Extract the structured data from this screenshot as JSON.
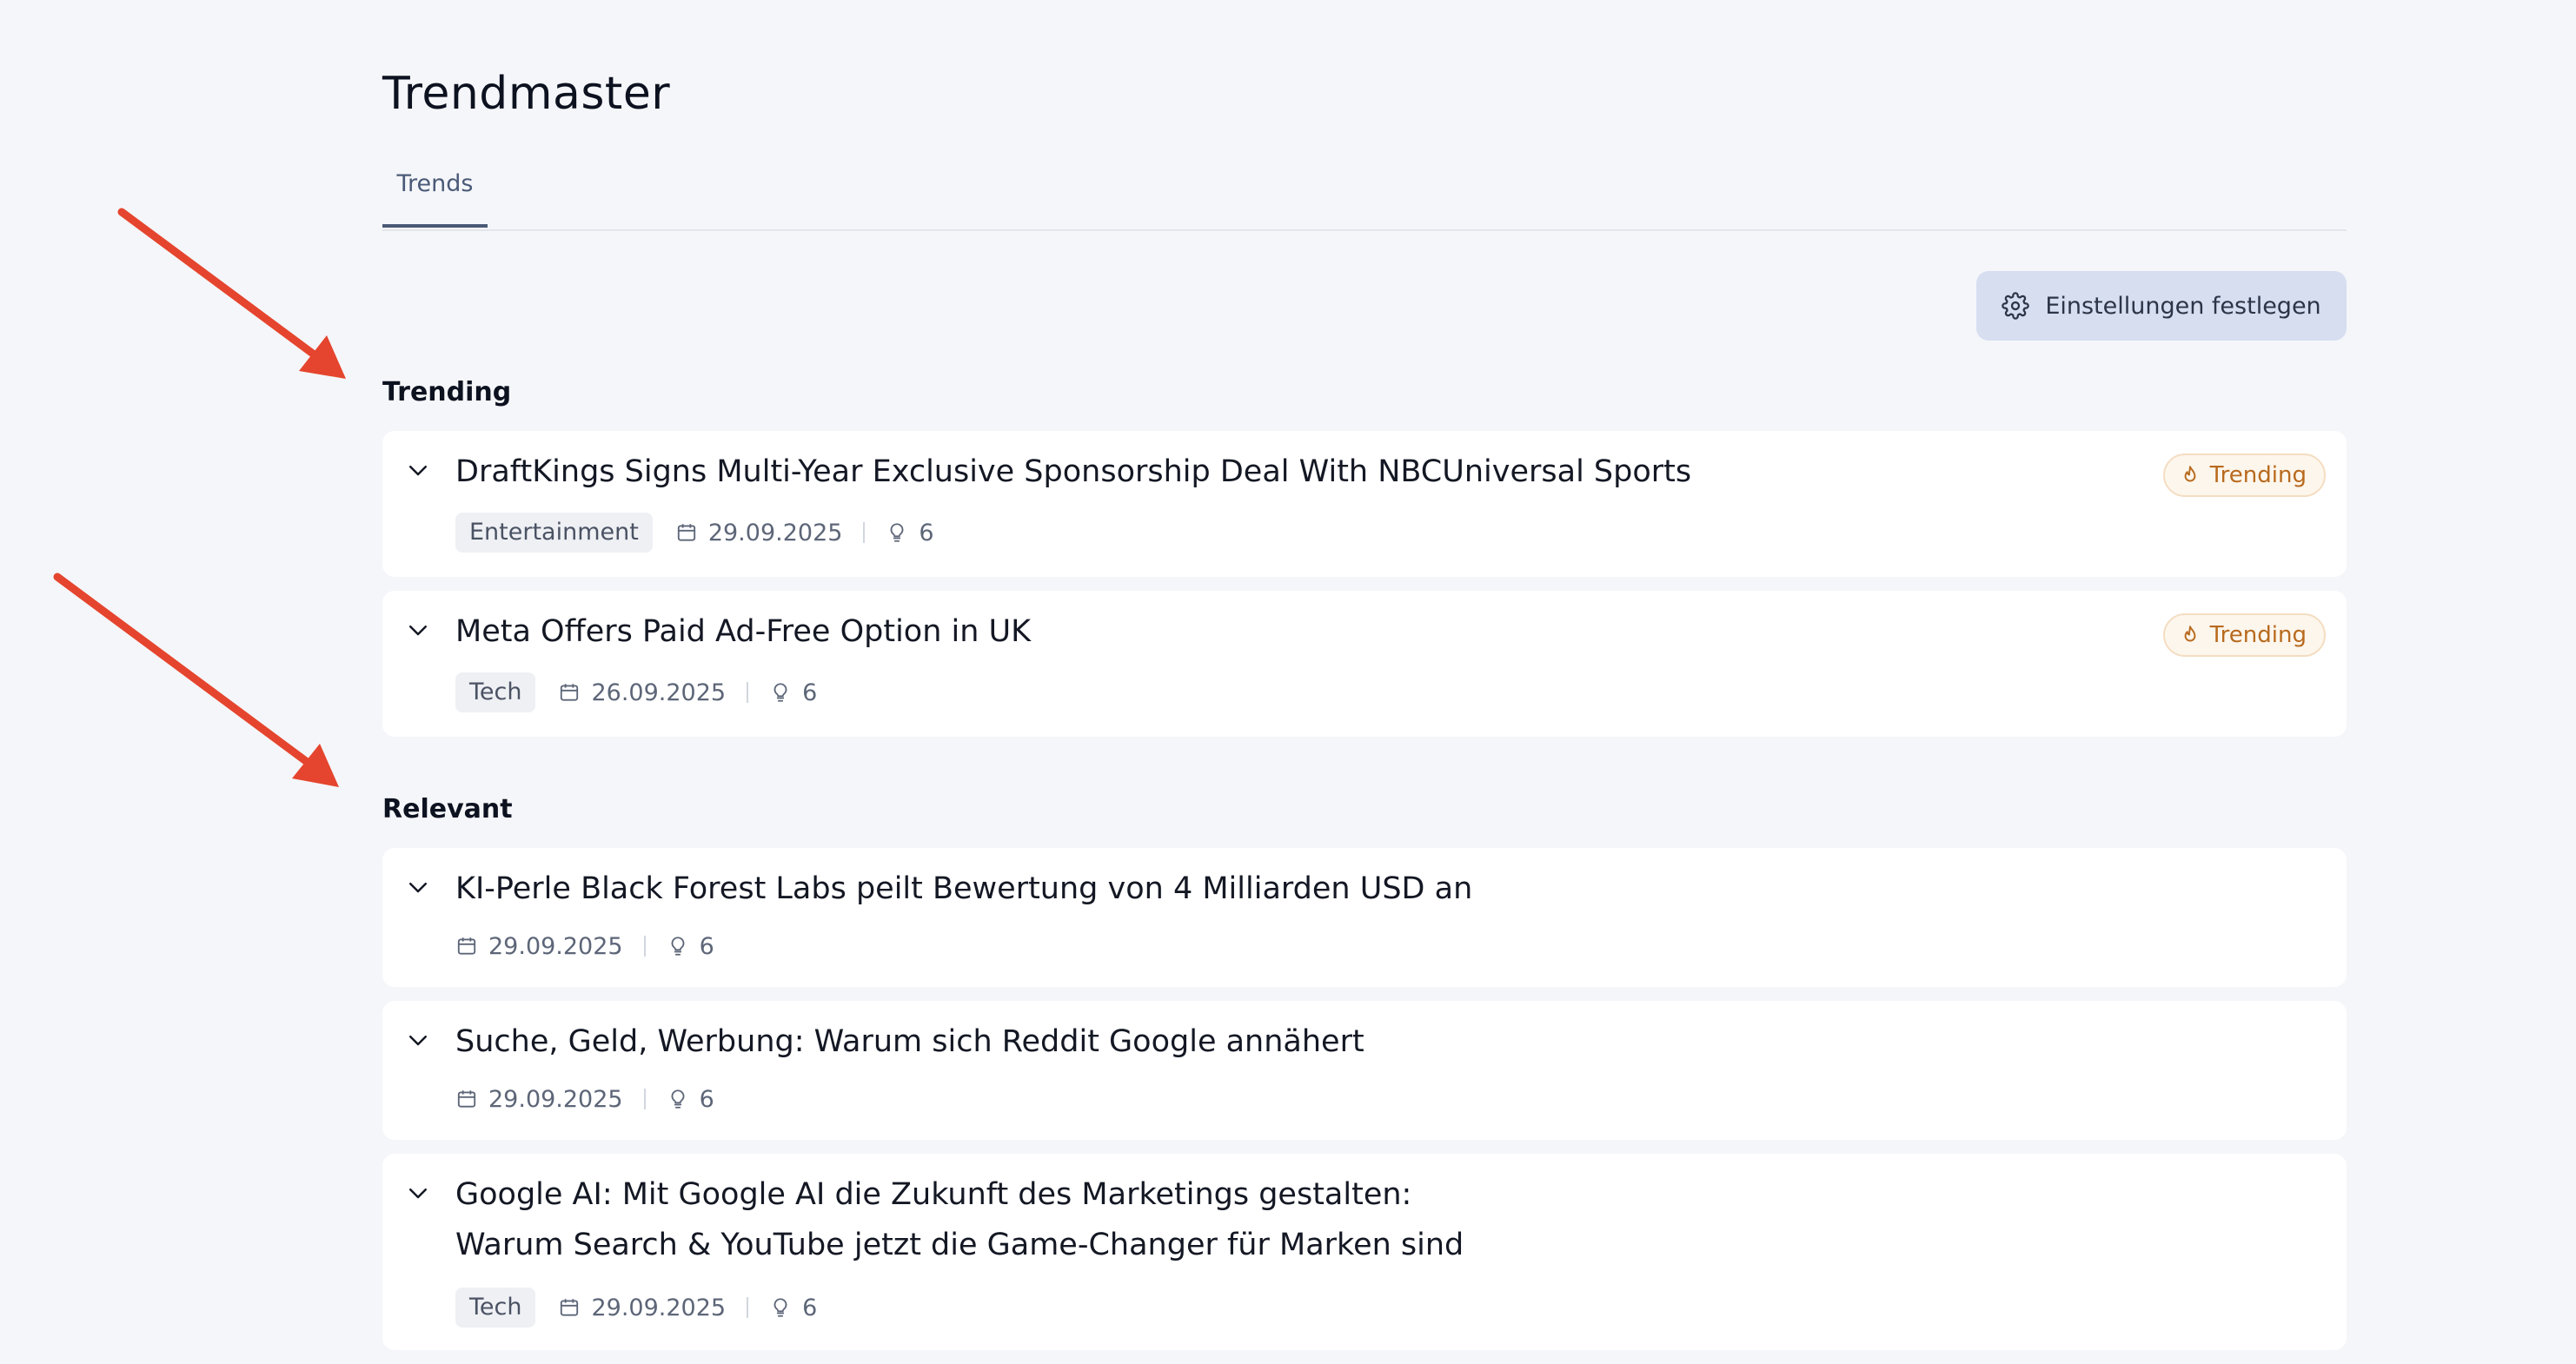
{
  "app": {
    "title": "Trendmaster"
  },
  "tabs": [
    {
      "label": "Trends"
    }
  ],
  "toolbar": {
    "settings_label": "Einstellungen festlegen"
  },
  "sections": {
    "trending": {
      "title": "Trending",
      "items": [
        {
          "title": "DraftKings Signs Multi-Year Exclusive Sponsorship Deal With NBCUniversal Sports",
          "tag": "Entertainment",
          "date": "29.09.2025",
          "count": "6",
          "badge": "Trending"
        },
        {
          "title": "Meta Offers Paid Ad-Free Option in UK",
          "tag": "Tech",
          "date": "26.09.2025",
          "count": "6",
          "badge": "Trending"
        }
      ]
    },
    "relevant": {
      "title": "Relevant",
      "items": [
        {
          "title": "KI-Perle Black Forest Labs peilt Bewertung von 4 Milliarden USD an",
          "date": "29.09.2025",
          "count": "6"
        },
        {
          "title": "Suche, Geld, Werbung: Warum sich Reddit Google annähert",
          "date": "29.09.2025",
          "count": "6"
        },
        {
          "title_line1": "Google AI: Mit Google AI die Zukunft des Marketings gestalten:",
          "title_line2": "Warum Search & YouTube jetzt die Game-Changer für Marken sind",
          "tag": "Tech",
          "date": "29.09.2025",
          "count": "6"
        }
      ]
    }
  },
  "icons": {
    "settings": "gear-icon",
    "expand": "chevron-down-icon",
    "date": "calendar-icon",
    "count": "lightbulb-icon",
    "badge": "flame-icon"
  },
  "colors": {
    "background": "#f5f6f9",
    "card": "#ffffff",
    "tab_accent": "#4a5a78",
    "settings_button": "#d6def0",
    "badge_text": "#b86a1e",
    "badge_bg": "#fdf6ec",
    "annotation_arrow": "#e5452e"
  }
}
